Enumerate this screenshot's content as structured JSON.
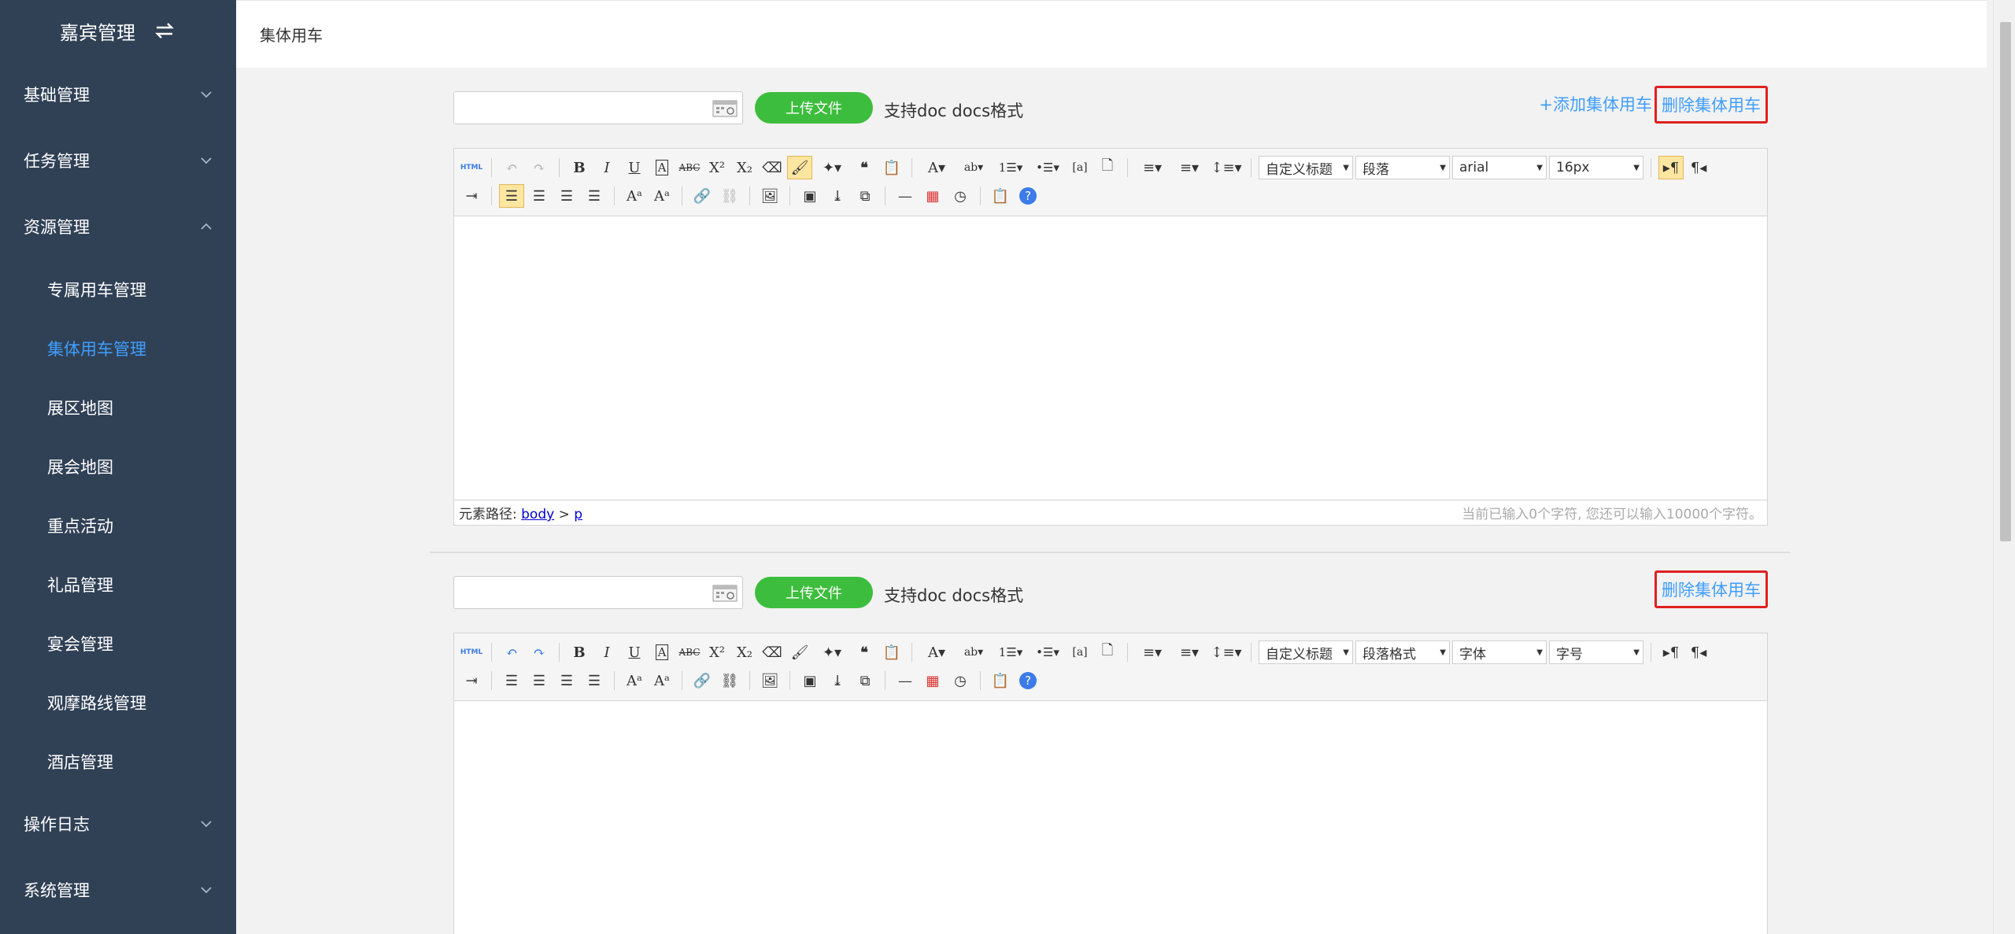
{
  "app": {
    "title": "嘉宾管理"
  },
  "sidebar": {
    "menus": [
      {
        "label": "基础管理",
        "expanded": false
      },
      {
        "label": "任务管理",
        "expanded": false
      },
      {
        "label": "资源管理",
        "expanded": true
      },
      {
        "label": "操作日志",
        "expanded": false
      },
      {
        "label": "系统管理",
        "expanded": false
      }
    ],
    "resource_items": [
      {
        "label": "专属用车管理",
        "active": false
      },
      {
        "label": "集体用车管理",
        "active": true
      },
      {
        "label": "展区地图",
        "active": false
      },
      {
        "label": "展会地图",
        "active": false
      },
      {
        "label": "重点活动",
        "active": false
      },
      {
        "label": "礼品管理",
        "active": false
      },
      {
        "label": "宴会管理",
        "active": false
      },
      {
        "label": "观摩路线管理",
        "active": false
      },
      {
        "label": "酒店管理",
        "active": false
      }
    ]
  },
  "page": {
    "breadcrumb": "集体用车"
  },
  "upload": {
    "button_label": "上传文件",
    "format_hint": "支持doc docs格式"
  },
  "actions": {
    "add_label": "+添加集体用车",
    "delete_label": "删除集体用车"
  },
  "editors": [
    {
      "heading_select": "自定义标题",
      "paragraph_select": "段落",
      "font_select": "arial",
      "size_select": "16px",
      "path_label": "元素路径:",
      "path_body": "body",
      "path_sep": ">",
      "path_p": "p",
      "counter": "当前已输入0个字符, 您还可以输入10000个字符。"
    },
    {
      "heading_select": "自定义标题",
      "paragraph_select": "段落格式",
      "font_select": "字体",
      "size_select": "字号"
    }
  ],
  "colors": {
    "sidebar_bg": "#304156",
    "active": "#409eff",
    "upload_green": "#3dbd3d",
    "highlight_red": "#e02020"
  }
}
